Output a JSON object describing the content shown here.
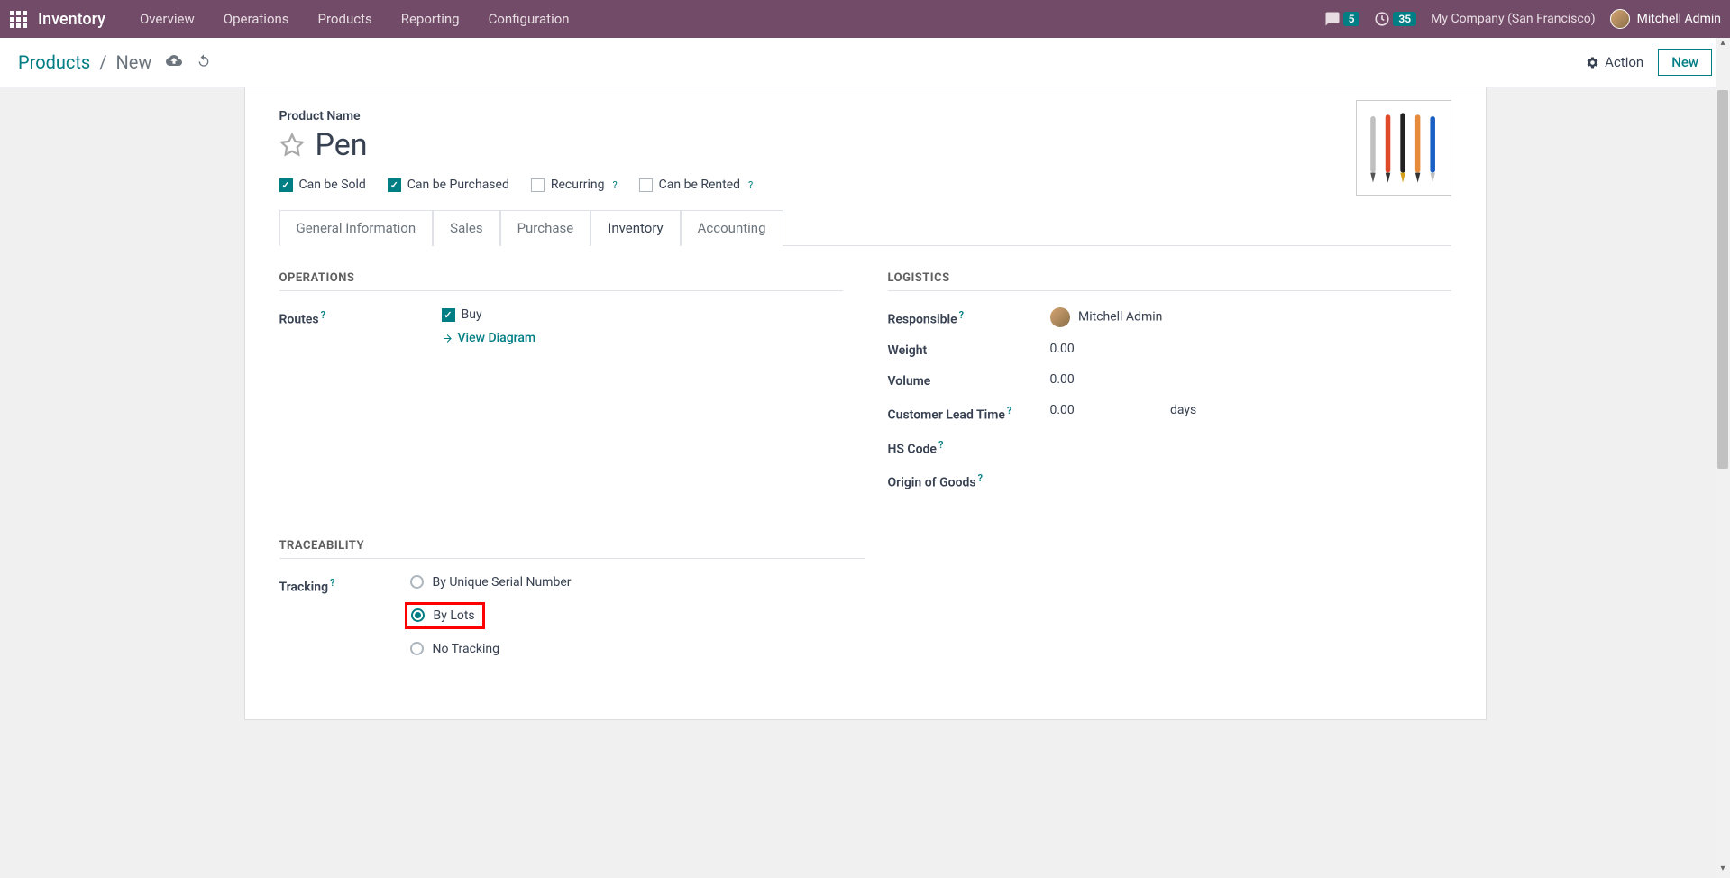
{
  "topbar": {
    "brand": "Inventory",
    "nav": [
      "Overview",
      "Operations",
      "Products",
      "Reporting",
      "Configuration"
    ],
    "messages_badge": "5",
    "activities_badge": "35",
    "company": "My Company (San Francisco)",
    "user": "Mitchell Admin"
  },
  "breadcrumb": {
    "parent": "Products",
    "current": "New",
    "action_label": "Action",
    "new_label": "New"
  },
  "product": {
    "name_label": "Product Name",
    "name": "Pen",
    "sold_label": "Can be Sold",
    "purchased_label": "Can be Purchased",
    "recurring_label": "Recurring",
    "rented_label": "Can be Rented"
  },
  "tabs": [
    "General Information",
    "Sales",
    "Purchase",
    "Inventory",
    "Accounting"
  ],
  "operations": {
    "title": "OPERATIONS",
    "routes_label": "Routes",
    "buy_label": "Buy",
    "view_diagram": "View Diagram"
  },
  "logistics": {
    "title": "LOGISTICS",
    "responsible_label": "Responsible",
    "responsible_value": "Mitchell Admin",
    "weight_label": "Weight",
    "weight_value": "0.00",
    "volume_label": "Volume",
    "volume_value": "0.00",
    "lead_time_label": "Customer Lead Time",
    "lead_time_value": "0.00",
    "lead_time_unit": "days",
    "hs_code_label": "HS Code",
    "origin_label": "Origin of Goods"
  },
  "traceability": {
    "title": "TRACEABILITY",
    "tracking_label": "Tracking",
    "options": [
      "By Unique Serial Number",
      "By Lots",
      "No Tracking"
    ]
  }
}
